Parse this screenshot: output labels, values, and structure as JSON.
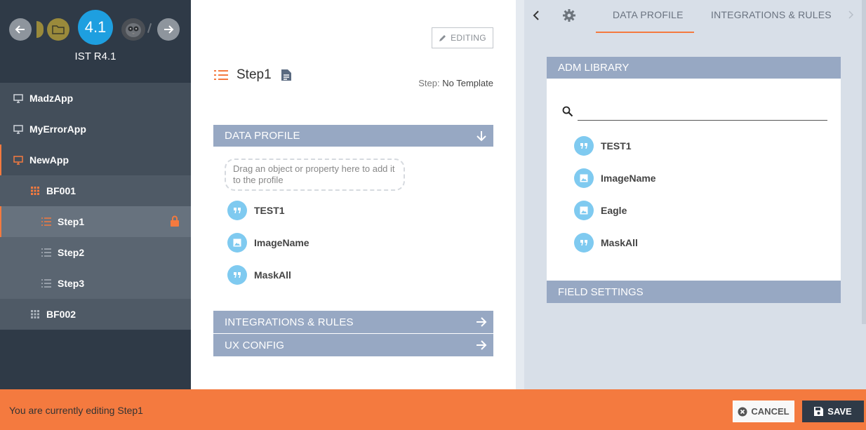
{
  "colors": {
    "accent": "#f47a3f",
    "sidebar_bg": "#2f3a47",
    "section_bar": "#97a8c3",
    "property_icon": "#7fcaf0",
    "version_badge": "#1e9fe0"
  },
  "header": {
    "version": "4.1",
    "app_name": "IST R4.1"
  },
  "sidebar": {
    "items": [
      {
        "label": "MadzApp",
        "icon": "monitor-icon"
      },
      {
        "label": "MyErrorApp",
        "icon": "monitor-icon"
      },
      {
        "label": "NewApp",
        "icon": "monitor-icon",
        "active": true
      },
      {
        "label": "BF001",
        "icon": "grid-icon"
      },
      {
        "label": "Step1",
        "icon": "list-icon",
        "active": true,
        "locked": true
      },
      {
        "label": "Step2",
        "icon": "list-icon"
      },
      {
        "label": "Step3",
        "icon": "list-icon"
      },
      {
        "label": "BF002",
        "icon": "grid-icon"
      }
    ]
  },
  "center": {
    "editing_label": "EDITING",
    "step_title": "Step1",
    "template_label": "Step:",
    "template_value": "No Template",
    "data_profile_label": "DATA PROFILE",
    "dropzone_text": "Drag an object or property here to add it to the profile",
    "profile_items": [
      {
        "label": "TEST1",
        "icon": "quote-icon"
      },
      {
        "label": "ImageName",
        "icon": "image-icon"
      },
      {
        "label": "MaskAll",
        "icon": "quote-icon"
      }
    ],
    "integrations_label": "INTEGRATIONS & RULES",
    "ux_config_label": "UX CONFIG"
  },
  "right": {
    "tabs": [
      "DATA PROFILE",
      "INTEGRATIONS & RULES"
    ],
    "active_tab": "DATA PROFILE",
    "adm_library_label": "ADM LIBRARY",
    "search_value": "",
    "library_items": [
      {
        "label": "TEST1",
        "icon": "quote-icon"
      },
      {
        "label": "ImageName",
        "icon": "image-icon"
      },
      {
        "label": "Eagle",
        "icon": "image-icon"
      },
      {
        "label": "MaskAll",
        "icon": "quote-icon"
      }
    ],
    "field_settings_label": "FIELD SETTINGS"
  },
  "footer": {
    "status": "You are currently editing Step1",
    "cancel_label": "CANCEL",
    "save_label": "SAVE"
  }
}
